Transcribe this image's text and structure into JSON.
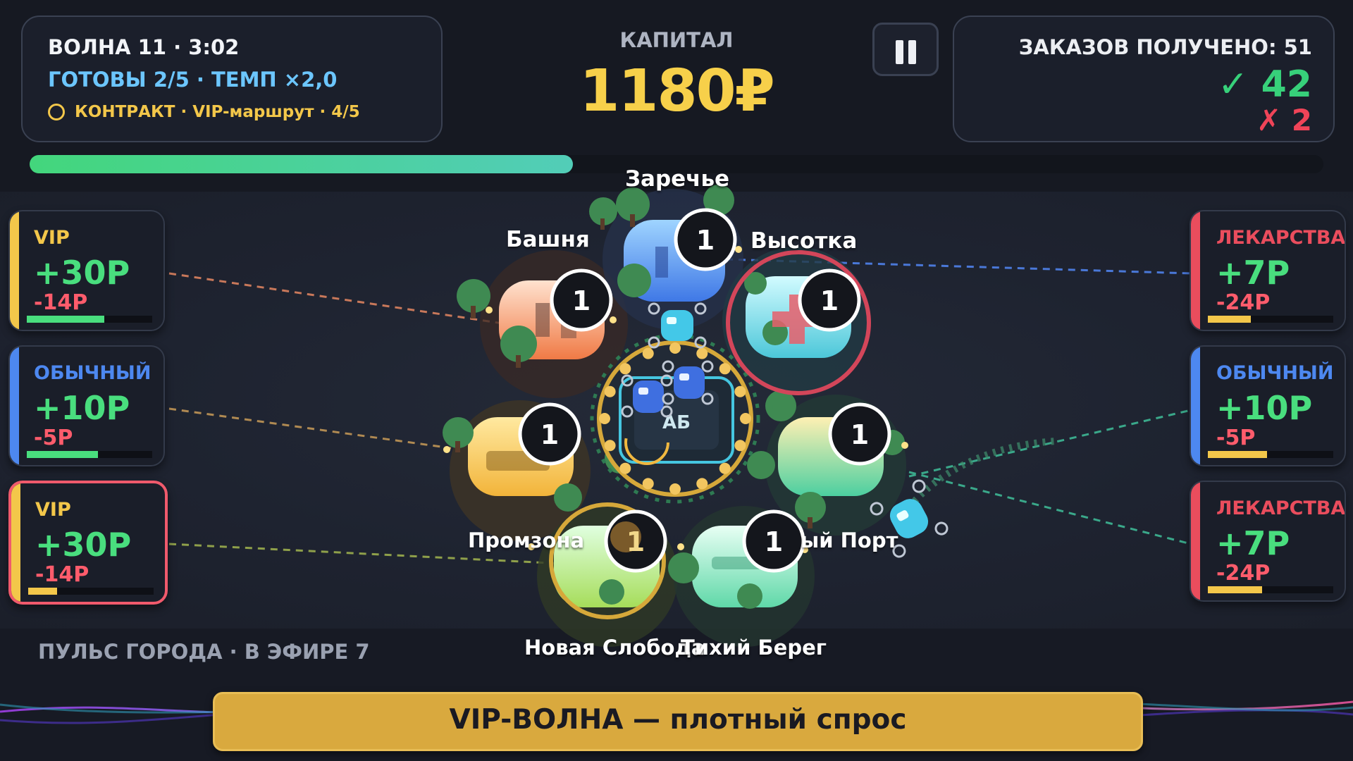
{
  "hud": {
    "wave_text": "ВОЛНА 11  ·  3:02",
    "ready_text": "ГОТОВЫ 2/5 · ТЕМП ×2,0",
    "contract_text": "КОНТРАКТ · VIP-маршрут · 4/5",
    "capital_label": "КАПИТАЛ",
    "capital_value": "1180₽",
    "orders_title": "ЗАКАЗОВ ПОЛУЧЕНО: 51",
    "orders_ok": "✓ 42",
    "orders_fail": "✗ 2",
    "wave_progress": 0.42
  },
  "colors": {
    "vip": "#f3c74a",
    "normal": "#4d88f0",
    "medicine": "#ea4d5d",
    "reward": "#49de7e",
    "penalty": "#ff5c6c",
    "capital": "#f7d04a"
  },
  "left_cards": [
    {
      "type": "VIP",
      "reward": "+30Р",
      "penalty": "-14Р",
      "timer": 0.62,
      "timer_color": "#49de7e",
      "accent": "#f3c74a",
      "selected": false
    },
    {
      "type": "ОБЫЧНЫЙ",
      "reward": "+10Р",
      "penalty": "-5Р",
      "timer": 0.57,
      "timer_color": "#49de7e",
      "accent": "#4d88f0",
      "selected": false
    },
    {
      "type": "VIP",
      "reward": "+30Р",
      "penalty": "-14Р",
      "timer": 0.23,
      "timer_color": "#f3c74a",
      "accent": "#f3c74a",
      "selected": true
    }
  ],
  "right_cards": [
    {
      "type": "ЛЕКАРСТВА",
      "reward": "+7Р",
      "penalty": "-24Р",
      "timer": 0.34,
      "timer_color": "#f3c74a",
      "accent": "#ea4d5d"
    },
    {
      "type": "ОБЫЧНЫЙ",
      "reward": "+10Р",
      "penalty": "-5Р",
      "timer": 0.47,
      "timer_color": "#f3c74a",
      "accent": "#4d88f0"
    },
    {
      "type": "ЛЕКАРСТВА",
      "reward": "+7Р",
      "penalty": "-24Р",
      "timer": 0.43,
      "timer_color": "#f3c74a",
      "accent": "#ea4d5d"
    }
  ],
  "districts": {
    "zarechye": "Заречье",
    "bashnya": "Башня",
    "vysotka": "Высотка",
    "promzona": "Промзона",
    "port": "ый Порт",
    "novaya_sloboda": "Новая Слобода",
    "tikhiy_bereg": "Тихий Берег"
  },
  "hub_label": "АБ",
  "node_count": "1",
  "pulse": "ПУЛЬС ГОРОДА · В ЭФИРЕ 7",
  "banner": "VIP-ВОЛНА — плотный спрос"
}
